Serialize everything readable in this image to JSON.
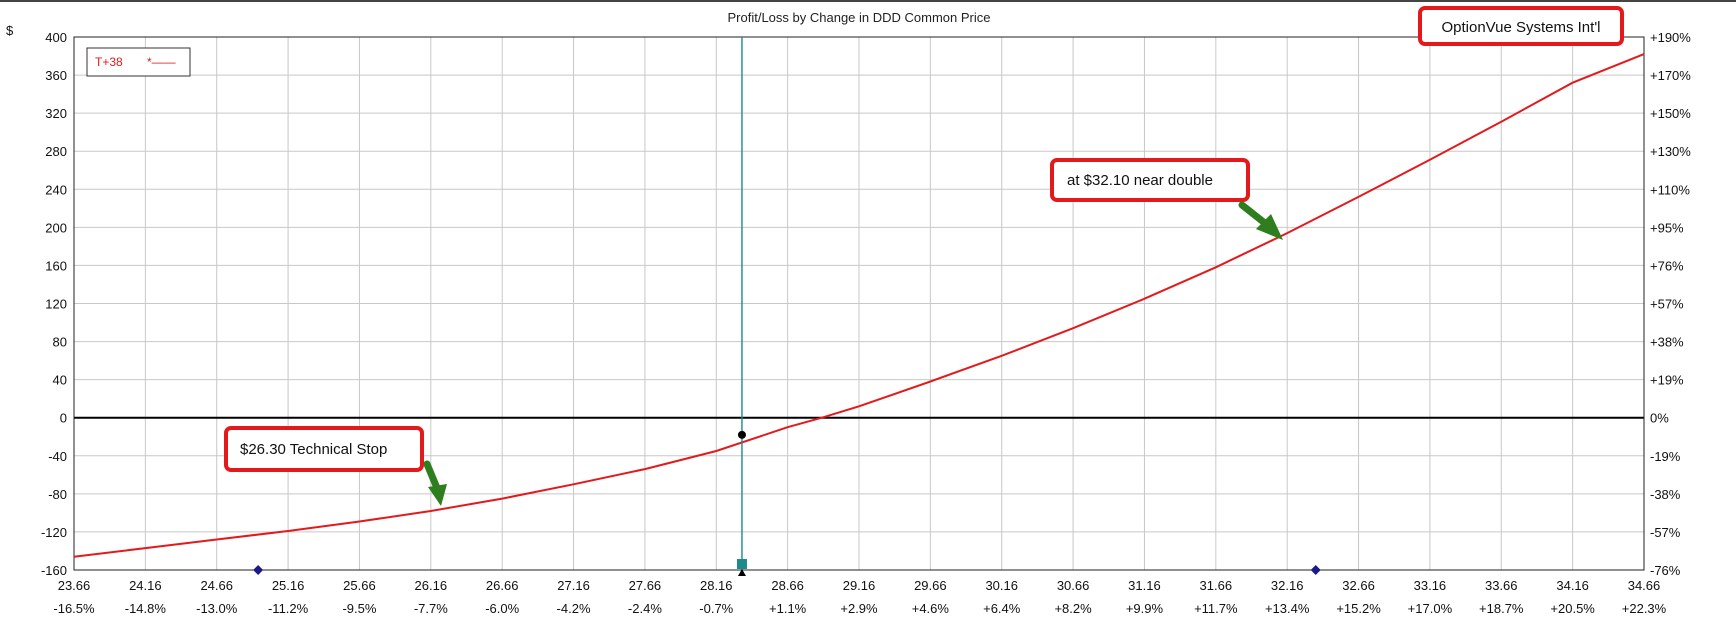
{
  "currency_symbol": "$",
  "watermark": "OptionVue Systems Int'l",
  "chart_data": {
    "type": "line",
    "title": "Profit/Loss by Change in DDD Common Price",
    "xlim": [
      23.66,
      34.66
    ],
    "ylim": [
      -160,
      400
    ],
    "x_ticks": [
      {
        "price": "23.66",
        "pct": "-16.5%"
      },
      {
        "price": "24.16",
        "pct": "-14.8%"
      },
      {
        "price": "24.66",
        "pct": "-13.0%"
      },
      {
        "price": "25.16",
        "pct": "-11.2%"
      },
      {
        "price": "25.66",
        "pct": "-9.5%"
      },
      {
        "price": "26.16",
        "pct": "-7.7%"
      },
      {
        "price": "26.66",
        "pct": "-6.0%"
      },
      {
        "price": "27.16",
        "pct": "-4.2%"
      },
      {
        "price": "27.66",
        "pct": "-2.4%"
      },
      {
        "price": "28.16",
        "pct": "-0.7%"
      },
      {
        "price": "28.66",
        "pct": "+1.1%"
      },
      {
        "price": "29.16",
        "pct": "+2.9%"
      },
      {
        "price": "29.66",
        "pct": "+4.6%"
      },
      {
        "price": "30.16",
        "pct": "+6.4%"
      },
      {
        "price": "30.66",
        "pct": "+8.2%"
      },
      {
        "price": "31.16",
        "pct": "+9.9%"
      },
      {
        "price": "31.66",
        "pct": "+11.7%"
      },
      {
        "price": "32.16",
        "pct": "+13.4%"
      },
      {
        "price": "32.66",
        "pct": "+15.2%"
      },
      {
        "price": "33.16",
        "pct": "+17.0%"
      },
      {
        "price": "33.66",
        "pct": "+18.7%"
      },
      {
        "price": "34.16",
        "pct": "+20.5%"
      },
      {
        "price": "34.66",
        "pct": "+22.3%"
      }
    ],
    "y_ticks": [
      {
        "value": 400,
        "label": "400",
        "right": "+190%"
      },
      {
        "value": 360,
        "label": "360",
        "right": "+170%"
      },
      {
        "value": 320,
        "label": "320",
        "right": "+150%"
      },
      {
        "value": 280,
        "label": "280",
        "right": "+130%"
      },
      {
        "value": 240,
        "label": "240",
        "right": "+110%"
      },
      {
        "value": 200,
        "label": "200",
        "right": "+95%"
      },
      {
        "value": 160,
        "label": "160",
        "right": "+76%"
      },
      {
        "value": 120,
        "label": "120",
        "right": "+57%"
      },
      {
        "value": 80,
        "label": "80",
        "right": "+38%"
      },
      {
        "value": 40,
        "label": "40",
        "right": "+19%"
      },
      {
        "value": 0,
        "label": "0",
        "right": "0%"
      },
      {
        "value": -40,
        "label": "-40",
        "right": "-19%"
      },
      {
        "value": -80,
        "label": "-80",
        "right": "-38%"
      },
      {
        "value": -120,
        "label": "-120",
        "right": "-57%"
      },
      {
        "value": -160,
        "label": "-160",
        "right": "-76%"
      }
    ],
    "grid": true,
    "legend": {
      "position": "top-left",
      "entries": [
        {
          "label": "T+38",
          "marker": "*——",
          "color": "#e31a1c"
        }
      ]
    },
    "series": [
      {
        "name": "T+38",
        "color": "#e31a1c",
        "x": [
          23.66,
          24.16,
          24.66,
          25.16,
          25.66,
          26.16,
          26.66,
          27.16,
          27.66,
          28.16,
          28.66,
          28.9,
          29.16,
          29.66,
          30.16,
          30.66,
          31.16,
          31.66,
          32.16,
          32.66,
          33.16,
          33.66,
          34.16,
          34.66
        ],
        "y": [
          -146,
          -137,
          -128,
          -119,
          -109,
          -98,
          -85,
          -70,
          -54,
          -35,
          -10,
          0,
          12,
          38,
          65,
          94,
          125,
          158,
          194,
          232,
          271,
          311,
          352,
          382
        ]
      }
    ],
    "current_price_line": 28.34,
    "current_point": {
      "x": 28.34,
      "y": -18
    },
    "axis_markers": [
      24.95,
      32.36
    ],
    "annotations": [
      {
        "text": "$26.30 Technical Stop",
        "x": 26.3,
        "y": -90
      },
      {
        "text": "at $32.10 near double",
        "x": 32.1,
        "y": 190
      }
    ],
    "colors": {
      "series": "#e31a1c",
      "current_line": "#1f8a8a",
      "callout": "#e3191c",
      "arrow": "#2e7d1f",
      "diamond": "#1a1a8c",
      "zero_line": "#000000"
    }
  }
}
